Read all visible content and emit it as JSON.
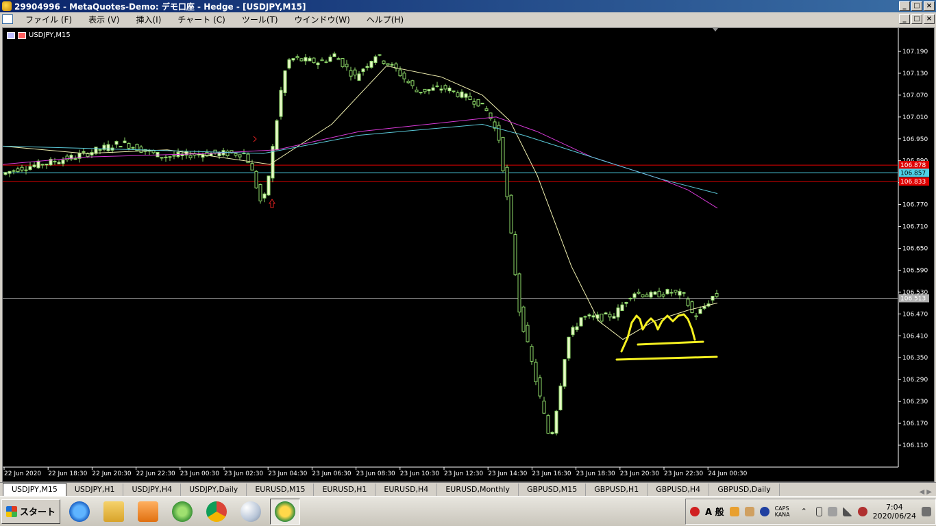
{
  "window": {
    "title": "29904996 - MetaQuotes-Demo: デモ口座 - Hedge - [USDJPY,M15]",
    "controls": {
      "minimize": "_",
      "maximize": "□",
      "close": "×"
    }
  },
  "menu": {
    "items": [
      "ファイル (F)",
      "表示 (V)",
      "挿入(I)",
      "チャート (C)",
      "ツール(T)",
      "ウインドウ(W)",
      "ヘルプ(H)"
    ]
  },
  "chart": {
    "symbol_label": "USDJPY,M15",
    "y_ticks": [
      "107.190",
      "107.130",
      "107.070",
      "107.010",
      "106.950",
      "106.890",
      "106.830",
      "106.770",
      "106.710",
      "106.650",
      "106.590",
      "106.530",
      "106.470",
      "106.410",
      "106.350",
      "106.290",
      "106.230",
      "106.170",
      "106.110"
    ],
    "price_labels": [
      {
        "text": "106.878",
        "color": "#e00000"
      },
      {
        "text": "106.857",
        "color": "#4dd2e8"
      },
      {
        "text": "106.833",
        "color": "#e00000"
      },
      {
        "text": "106.513",
        "color": "#b0b0b0"
      }
    ],
    "x_ticks": [
      "22 Jun 2020",
      "22 Jun 18:30",
      "22 Jun 20:30",
      "22 Jun 22:30",
      "23 Jun 00:30",
      "23 Jun 02:30",
      "23 Jun 04:30",
      "23 Jun 06:30",
      "23 Jun 08:30",
      "23 Jun 10:30",
      "23 Jun 12:30",
      "23 Jun 14:30",
      "23 Jun 16:30",
      "23 Jun 18:30",
      "23 Jun 20:30",
      "23 Jun 22:30",
      "24 Jun 00:30"
    ],
    "colors": {
      "background": "#000000",
      "candle_bull": "#e8f8c8",
      "candle_bear": "#000000",
      "wick": "#8fdc6a",
      "ma_fast": "#f0f0b0",
      "ma_mid": "#d83ad8",
      "ma_slow": "#5ac8d8",
      "hline": "#d00000",
      "annotation": "#f5f020"
    }
  },
  "tabs": [
    "USDJPY,M15",
    "USDJPY,H1",
    "USDJPY,H4",
    "USDJPY,Daily",
    "EURUSD,M15",
    "EURUSD,H1",
    "EURUSD,H4",
    "EURUSD,Monthly",
    "GBPUSD,M15",
    "GBPUSD,H1",
    "GBPUSD,H4",
    "GBPUSD,Daily"
  ],
  "taskbar": {
    "start_label": "スタート",
    "apps": [
      "internet-explorer-icon",
      "file-explorer-icon",
      "media-player-icon",
      "network-globe-icon",
      "chrome-icon",
      "paint-icon",
      "metatrader-icon"
    ],
    "tray": {
      "ime_mode": "A 般",
      "caps": "CAPS KANA"
    },
    "clock": {
      "time": "7:04",
      "date": "2020/06/24"
    }
  }
}
